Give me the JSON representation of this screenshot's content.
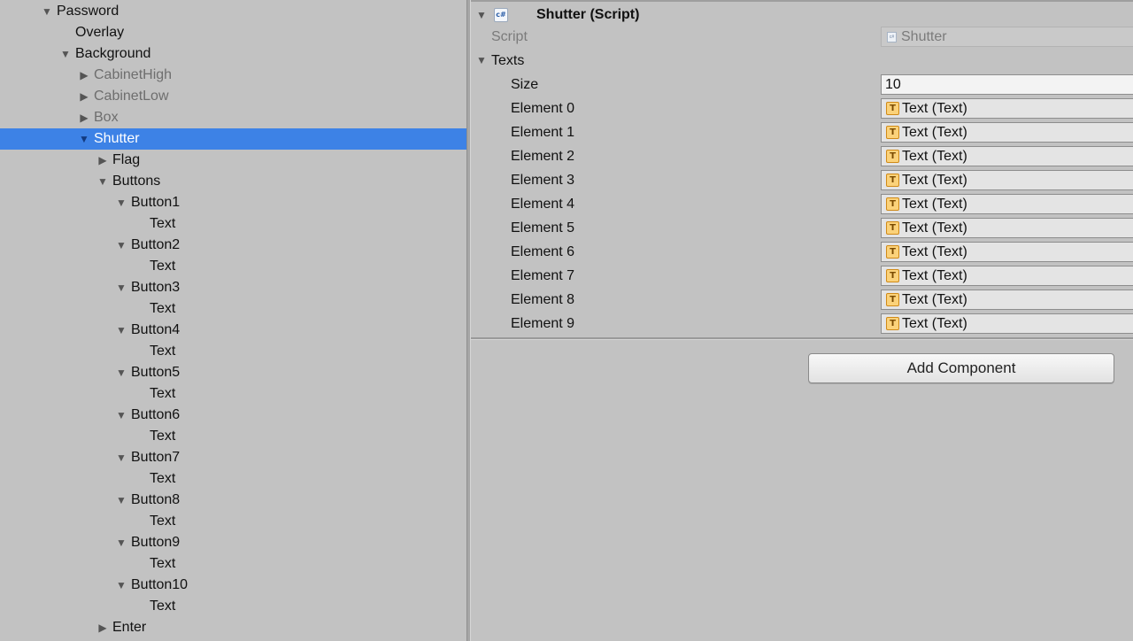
{
  "hierarchy": {
    "items": [
      {
        "label": "Password",
        "expanded": true
      },
      {
        "label": "Overlay"
      },
      {
        "label": "Background",
        "expanded": true
      },
      {
        "label": "CabinetHigh",
        "expanded": false
      },
      {
        "label": "CabinetLow",
        "expanded": false
      },
      {
        "label": "Box",
        "expanded": false
      },
      {
        "label": "Shutter",
        "expanded": true,
        "selected": true
      },
      {
        "label": "Flag",
        "expanded": false
      },
      {
        "label": "Buttons",
        "expanded": true
      },
      {
        "label": "Button1",
        "expanded": true
      },
      {
        "label": "Text"
      },
      {
        "label": "Button2",
        "expanded": true
      },
      {
        "label": "Text"
      },
      {
        "label": "Button3",
        "expanded": true
      },
      {
        "label": "Text"
      },
      {
        "label": "Button4",
        "expanded": true
      },
      {
        "label": "Text"
      },
      {
        "label": "Button5",
        "expanded": true
      },
      {
        "label": "Text"
      },
      {
        "label": "Button6",
        "expanded": true
      },
      {
        "label": "Text"
      },
      {
        "label": "Button7",
        "expanded": true
      },
      {
        "label": "Text"
      },
      {
        "label": "Button8",
        "expanded": true
      },
      {
        "label": "Text"
      },
      {
        "label": "Button9",
        "expanded": true
      },
      {
        "label": "Text"
      },
      {
        "label": "Button10",
        "expanded": true
      },
      {
        "label": "Text"
      },
      {
        "label": "Enter",
        "expanded": false
      }
    ]
  },
  "inspector": {
    "component": {
      "title": "Shutter (Script)",
      "badge": "c#"
    },
    "script": {
      "label": "Script",
      "value": "Shutter"
    },
    "texts": {
      "label": "Texts",
      "size_label": "Size",
      "size_value": "10",
      "elements": [
        {
          "label": "Element 0",
          "value": "Text (Text)"
        },
        {
          "label": "Element 1",
          "value": "Text (Text)"
        },
        {
          "label": "Element 2",
          "value": "Text (Text)"
        },
        {
          "label": "Element 3",
          "value": "Text (Text)"
        },
        {
          "label": "Element 4",
          "value": "Text (Text)"
        },
        {
          "label": "Element 5",
          "value": "Text (Text)"
        },
        {
          "label": "Element 6",
          "value": "Text (Text)"
        },
        {
          "label": "Element 7",
          "value": "Text (Text)"
        },
        {
          "label": "Element 8",
          "value": "Text (Text)"
        },
        {
          "label": "Element 9",
          "value": "Text (Text)"
        }
      ]
    },
    "add_component_label": "Add Component"
  },
  "colors": {
    "panel_bg": "#c2c2c2",
    "selection": "#3d82e6",
    "text_icon": "#fbd27a"
  }
}
